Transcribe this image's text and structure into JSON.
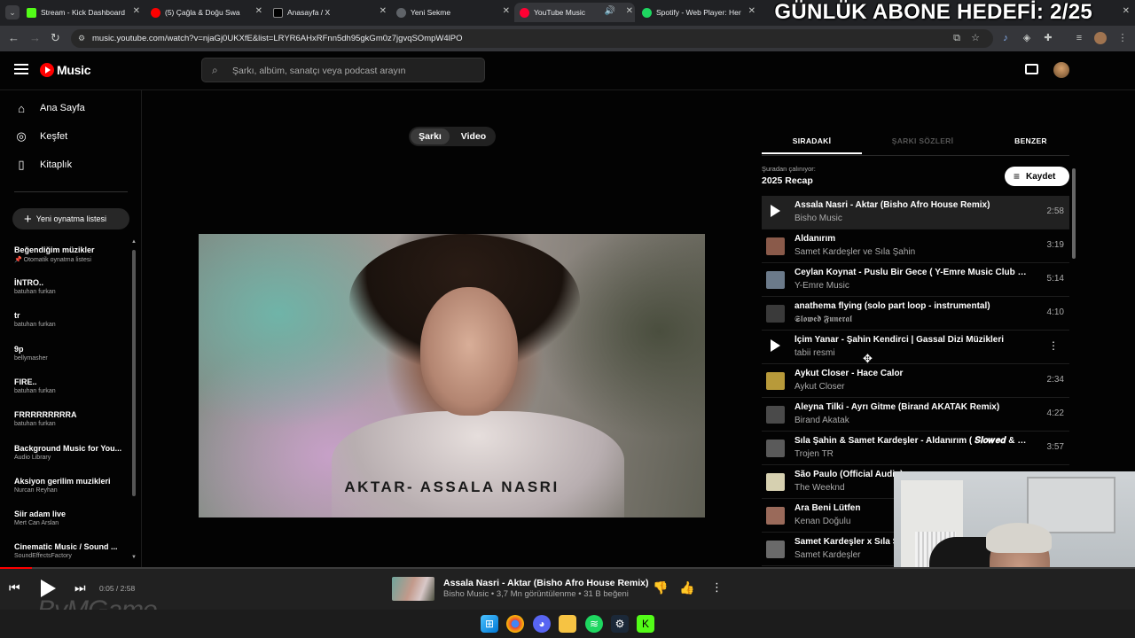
{
  "browser": {
    "tabs": [
      {
        "title": "Stream - Kick Dashboard",
        "color": "#53fc18"
      },
      {
        "title": "(5) Çağla & Doğu Swa",
        "color": "#ff0000"
      },
      {
        "title": "Anasayfa / X",
        "color": "#000000"
      },
      {
        "title": "Yeni Sekme",
        "color": "#5f6368"
      },
      {
        "title": "YouTube Music",
        "color": "#ff0033"
      },
      {
        "title": "Spotify - Web Player: Her",
        "color": "#1ed760"
      }
    ],
    "url": "music.youtube.com/watch?v=njaGj0UKXfE&list=LRYR6AHxRFnn5dh95gkGm0z7jgvqSOmpW4lPO",
    "overlay_text": "GÜNLÜK ABONE HEDEFİ: 2/25"
  },
  "header": {
    "logo_text": "Music",
    "search_placeholder": "Şarkı, albüm, sanatçı veya podcast arayın"
  },
  "sidebar": {
    "nav": [
      {
        "label": "Ana Sayfa",
        "icon": "home-icon"
      },
      {
        "label": "Keşfet",
        "icon": "compass-icon"
      },
      {
        "label": "Kitaplık",
        "icon": "library-icon"
      }
    ],
    "new_playlist_label": "Yeni oynatma listesi",
    "playlists": [
      {
        "title": "Beğendiğim müzikler",
        "subtitle": "Otomatik oynatma listesi"
      },
      {
        "title": "İNTRO..",
        "subtitle": "batuhan furkan"
      },
      {
        "title": "tr",
        "subtitle": "batuhan furkan"
      },
      {
        "title": "9p",
        "subtitle": "bellymasher"
      },
      {
        "title": "FIRE..",
        "subtitle": "batuhan furkan"
      },
      {
        "title": "FRRRRRRRRRA",
        "subtitle": "batuhan furkan"
      },
      {
        "title": "Background Music for You...",
        "subtitle": "Audio Library"
      },
      {
        "title": "Aksiyon gerilim muzikleri",
        "subtitle": "Nurcan Reyhan"
      },
      {
        "title": "Siir adam live",
        "subtitle": "Mert Can Arslan"
      },
      {
        "title": "Cinematic Music / Sound ...",
        "subtitle": "SoundEffectsFactory"
      }
    ]
  },
  "main": {
    "toggle": {
      "song": "Şarkı",
      "video": "Video"
    },
    "art_caption": "AKTAR- ASSALA NASRI"
  },
  "right_panel": {
    "tabs": [
      "SIRADAKİ",
      "ŞARKI SÖZLERİ",
      "BENZER"
    ],
    "playing_from_label": "Şuradan çalınıyor:",
    "playlist_name": "2025 Recap",
    "save_label": "Kaydet",
    "queue": [
      {
        "title": "Assala Nasri - Aktar (Bisho Afro House Remix)",
        "artist": "Bisho Music",
        "duration": "2:58",
        "thumb": "#2a2a2a"
      },
      {
        "title": "Aldanırım",
        "artist": "Samet Kardeşler ve Sıla Şahin",
        "duration": "3:19",
        "thumb": "#8a5a4a"
      },
      {
        "title": "Ceylan Koynat - Puslu Bir Gece ( Y-Emre Music Club R...",
        "artist": "Y-Emre Music",
        "duration": "5:14",
        "thumb": "#6b7a8a"
      },
      {
        "title": "anathema flying (solo part loop - instrumental)",
        "artist": "𝕾𝖑𝖔𝖜𝖊𝖉 𝕱𝖚𝖓𝖊𝖗𝖆𝖑",
        "duration": "4:10",
        "thumb": "#3a3a3a"
      },
      {
        "title": "İçim Yanar - Şahin Kendirci | Gassal Dizi Müzikleri",
        "artist": "tabii resmi",
        "duration": "",
        "thumb": "#2a2a2a"
      },
      {
        "title": "Aykut Closer - Hace Calor",
        "artist": "Aykut Closer",
        "duration": "2:34",
        "thumb": "#b89a3a"
      },
      {
        "title": "Aleyna Tilki - Ayrı Gitme (Birand AKATAK Remix)",
        "artist": "Birand Akatak",
        "duration": "4:22",
        "thumb": "#4a4a4a"
      },
      {
        "title": "Sıla Şahin & Samet Kardeşler - Aldanırım ( 𝑺𝒍𝒐𝒘𝒆𝒅 & 𝑹...",
        "artist": "Trojen TR",
        "duration": "3:57",
        "thumb": "#5a5a5a"
      },
      {
        "title": "São Paulo (Official Audio)",
        "artist": "The Weeknd",
        "duration": "",
        "thumb": "#d6d0b0"
      },
      {
        "title": "Ara Beni Lütfen",
        "artist": "Kenan Doğulu",
        "duration": "",
        "thumb": "#9a6a5a"
      },
      {
        "title": "Samet Kardeşler x Sıla Şahin",
        "artist": "Samet Kardeşler",
        "duration": "",
        "thumb": "#6a6a6a"
      }
    ]
  },
  "player": {
    "time": "0:05 / 2:58",
    "progress": 0.028,
    "title": "Assala Nasri - Aktar (Bisho Afro House Remix)",
    "subtitle": "Bisho Music • 3,7 Mn görüntülenme • 31 B beğeni",
    "watermark": "ByMGame"
  },
  "colors": {
    "accent": "#ff0000",
    "background": "#030303",
    "surface": "#212121"
  }
}
